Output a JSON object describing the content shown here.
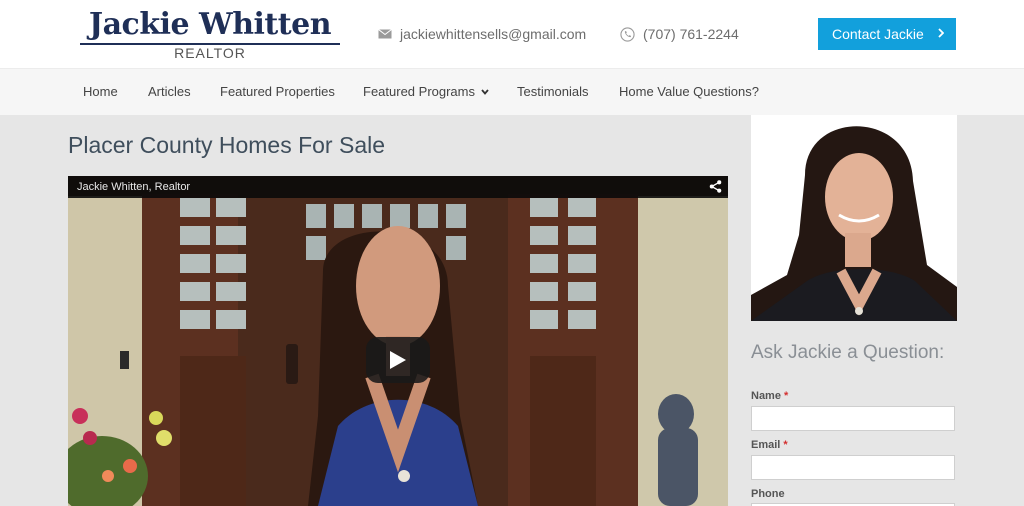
{
  "header": {
    "logo": {
      "name": "Jackie Whitten",
      "subtitle": "REALTOR"
    },
    "email": {
      "icon": "envelope-icon",
      "text": "jackiewhittensells@gmail.com"
    },
    "phone": {
      "icon": "phone-icon",
      "text": "(707) 761-2244"
    },
    "cta": {
      "label": "Contact Jackie",
      "icon": "chevron-right-icon"
    }
  },
  "nav": {
    "items": [
      {
        "label": "Home"
      },
      {
        "label": "Articles"
      },
      {
        "label": "Featured Properties"
      },
      {
        "label": "Featured Programs",
        "icon": "chevron-down-icon"
      },
      {
        "label": "Testimonials"
      },
      {
        "label": "Home Value Questions?"
      }
    ]
  },
  "main": {
    "title": "Placer County Homes For Sale",
    "video": {
      "title": "Jackie Whitten, Realtor",
      "share_icon": "share-icon",
      "play_icon": "play-icon"
    }
  },
  "sidebar": {
    "form": {
      "heading": "Ask Jackie a Question:",
      "fields": [
        {
          "label": "Name",
          "required_mark": "*"
        },
        {
          "label": "Email",
          "required_mark": "*"
        },
        {
          "label": "Phone"
        }
      ]
    }
  },
  "colors": {
    "brand_navy": "#1f2f57",
    "cta_blue": "#12a0dc",
    "required_red": "#d32f2f",
    "nav_background": "#f6f6f6",
    "page_background": "#e6e6e6"
  }
}
